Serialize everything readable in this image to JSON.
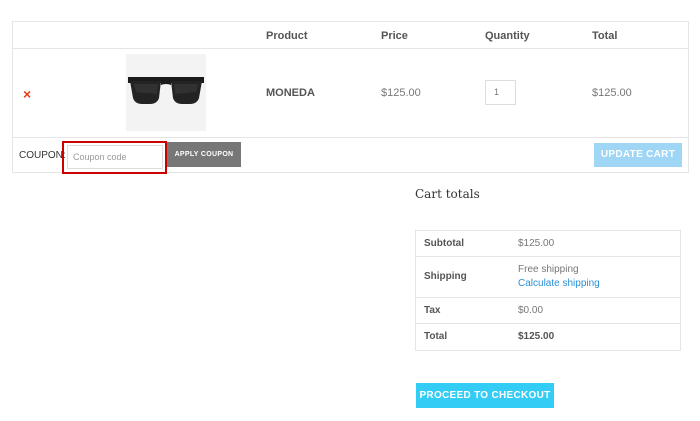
{
  "cart": {
    "headers": {
      "product": "Product",
      "price": "Price",
      "quantity": "Quantity",
      "total": "Total"
    },
    "item": {
      "remove_glyph": "×",
      "name": "MONEDA",
      "price": "$125.00",
      "quantity": "1",
      "total": "$125.00",
      "image": "sunglasses"
    },
    "coupon_label": "COUPON:",
    "coupon_placeholder": "Coupon code",
    "apply_label": "APPLY COUPON",
    "update_label": "UPDATE CART"
  },
  "totals": {
    "title": "Cart totals",
    "subtotal_label": "Subtotal",
    "subtotal_value": "$125.00",
    "shipping_label": "Shipping",
    "shipping_value": "Free shipping",
    "shipping_link": "Calculate shipping",
    "tax_label": "Tax",
    "tax_value": "$0.00",
    "total_label": "Total",
    "total_value": "$125.00"
  },
  "checkout_label": "PROCEED TO CHECKOUT",
  "colors": {
    "remove": "#e2401c",
    "coupon_highlight": "#cc0000",
    "apply_button": "#777777",
    "update_button": "#9fd5f5",
    "checkout_button": "#33ccf5",
    "link": "#2a8fd7"
  }
}
